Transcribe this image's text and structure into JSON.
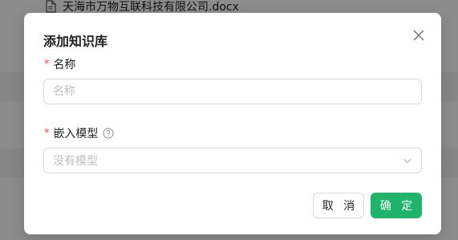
{
  "background": {
    "file_name": "天海市万物互联科技有限公司.docx"
  },
  "modal": {
    "title": "添加知识库",
    "required_mark": "*",
    "name_field": {
      "label": "名称",
      "placeholder": "名称",
      "value": ""
    },
    "model_field": {
      "label": "嵌入模型",
      "placeholder": "没有模型"
    },
    "buttons": {
      "cancel": "取 消",
      "ok": "确 定"
    }
  },
  "colors": {
    "primary": "#1fb36b",
    "required": "#ff4d4f"
  },
  "icons": {
    "file": "document-icon",
    "close": "close-icon",
    "help": "question-circle-icon",
    "chevron": "chevron-down-icon"
  }
}
